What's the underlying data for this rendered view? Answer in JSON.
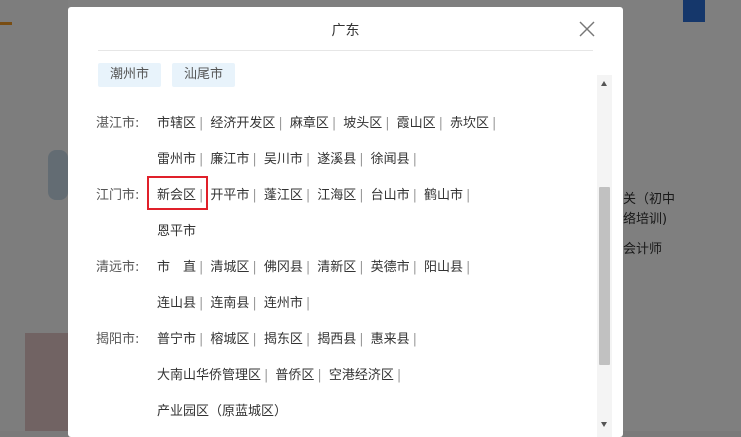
{
  "background": {
    "right_texts": [
      "关（初中",
      "络培训)",
      "会计师"
    ]
  },
  "modal": {
    "title": "广东",
    "top_chips": [
      "潮州市",
      "汕尾市"
    ],
    "regions": [
      {
        "province_label": "湛江市:",
        "lines": [
          [
            "市辖区",
            "经济开发区",
            "麻章区",
            "坡头区",
            "霞山区",
            "赤坎区"
          ],
          [
            "雷州市",
            "廉江市",
            "吴川市",
            "遂溪县",
            "徐闻县"
          ]
        ]
      },
      {
        "province_label": "江门市:",
        "lines": [
          [
            "新会区",
            "开平市",
            "蓬江区",
            "江海区",
            "台山市",
            "鹤山市"
          ],
          [
            "恩平市"
          ]
        ]
      },
      {
        "province_label": "清远市:",
        "lines": [
          [
            "市　直",
            "清城区",
            "佛冈县",
            "清新区",
            "英德市",
            "阳山县"
          ],
          [
            "连山县",
            "连南县",
            "连州市"
          ]
        ]
      },
      {
        "province_label": "揭阳市:",
        "lines": [
          [
            "普宁市",
            "榕城区",
            "揭东区",
            "揭西县",
            "惠来县"
          ],
          [
            "大南山华侨管理区",
            "普侨区",
            "空港经济区"
          ],
          [
            "产业园区（原蓝城区）"
          ]
        ]
      }
    ],
    "highlighted_city": "新会区"
  }
}
